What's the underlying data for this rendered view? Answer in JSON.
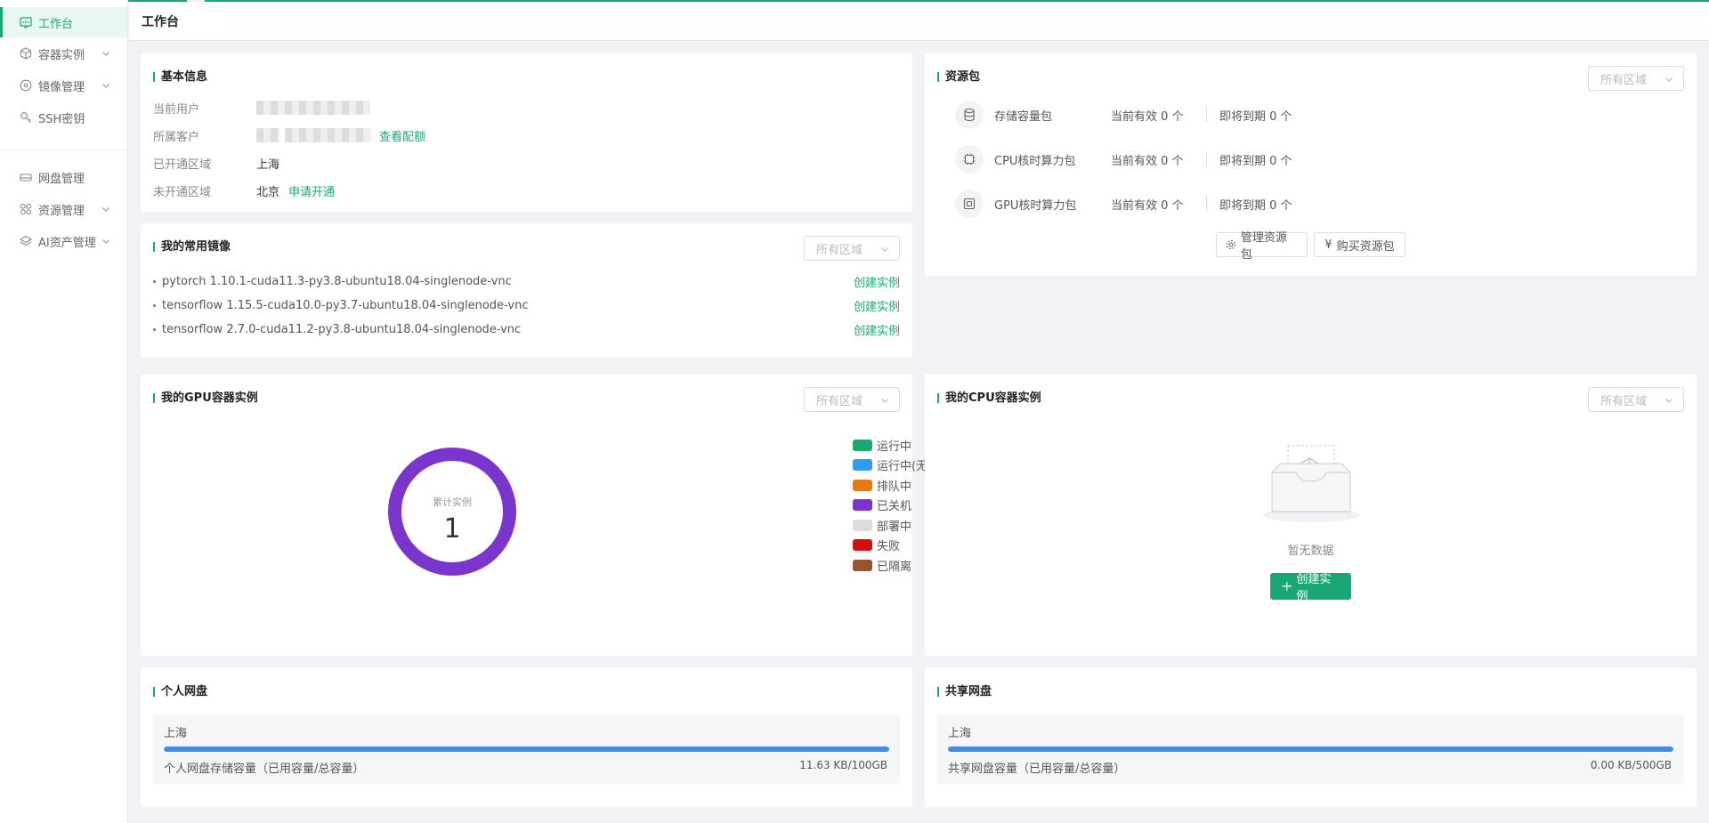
{
  "app": {
    "page_title": "工作台"
  },
  "sidebar": {
    "items": [
      {
        "label": "工作台",
        "icon": "dashboard-icon"
      },
      {
        "label": "容器实例",
        "icon": "cube-icon"
      },
      {
        "label": "镜像管理",
        "icon": "image-disc-icon"
      },
      {
        "label": "SSH密钥",
        "icon": "key-icon"
      },
      {
        "label": "网盘管理",
        "icon": "disk-icon"
      },
      {
        "label": "资源管理",
        "icon": "grid-icon"
      },
      {
        "label": "AI资产管理",
        "icon": "layers-icon"
      }
    ]
  },
  "basic_info": {
    "title": "基本信息",
    "user_label": "当前用户",
    "customer_label": "所属客户",
    "view_quota": "查看配额",
    "opened_label": "已开通区域",
    "opened_value": "上海",
    "unopened_label": "未开通区域",
    "unopened_value": "北京",
    "apply_open": "申请开通"
  },
  "images": {
    "title": "我的常用镜像",
    "region_placeholder": "所有区域",
    "items": [
      {
        "name": "pytorch 1.10.1-cuda11.3-py3.8-ubuntu18.04-singlenode-vnc",
        "action": "创建实例"
      },
      {
        "name": "tensorflow 1.15.5-cuda10.0-py3.7-ubuntu18.04-singlenode-vnc",
        "action": "创建实例"
      },
      {
        "name": "tensorflow 2.7.0-cuda11.2-py3.8-ubuntu18.04-singlenode-vnc",
        "action": "创建实例"
      }
    ]
  },
  "resource_pack": {
    "title": "资源包",
    "region_placeholder": "所有区域",
    "items": [
      {
        "name": "存储容量包",
        "icon": "database-icon",
        "active": "当前有效 0 个",
        "expiring": "即将到期 0 个"
      },
      {
        "name": "CPU核时算力包",
        "icon": "cpu-chip-icon",
        "active": "当前有效 0 个",
        "expiring": "即将到期 0 个"
      },
      {
        "name": "GPU核时算力包",
        "icon": "gpu-chip-icon",
        "active": "当前有效 0 个",
        "expiring": "即将到期 0 个"
      }
    ],
    "manage_button": "管理资源包",
    "buy_button": "购买资源包"
  },
  "gpu_instances": {
    "title": "我的GPU容器实例",
    "region_placeholder": "所有区域",
    "center_label": "累计实例",
    "center_value": "1",
    "legend": [
      {
        "label": "运行中",
        "value": "0",
        "color": "#1aa86f"
      },
      {
        "label": "运行中(无卡)",
        "value": "0",
        "color": "#2f9bea"
      },
      {
        "label": "排队中",
        "value": "0",
        "color": "#e27a10"
      },
      {
        "label": "已关机",
        "value": "1",
        "color": "#7b35cc"
      },
      {
        "label": "部署中",
        "value": "0",
        "color": "#dcdcdc"
      },
      {
        "label": "失败",
        "value": "0",
        "color": "#d40f0f"
      },
      {
        "label": "已隔离",
        "value": "0",
        "color": "#98542c"
      }
    ],
    "ring_color": "#7b35cc"
  },
  "cpu_instances": {
    "title": "我的CPU容器实例",
    "region_placeholder": "所有区域",
    "empty_text": "暂无数据",
    "create_button": "创建实例"
  },
  "personal_disk": {
    "title": "个人网盘",
    "region": "上海",
    "label": "个人网盘存储容量（已用容量/总容量）",
    "value": "11.63 KB/100GB",
    "fill_fraction": 1.0
  },
  "shared_disk": {
    "title": "共享网盘",
    "region": "上海",
    "label": "共享网盘容量（已用容量/总容量）",
    "value": "0.00 KB/500GB",
    "fill_fraction": 1.0
  }
}
